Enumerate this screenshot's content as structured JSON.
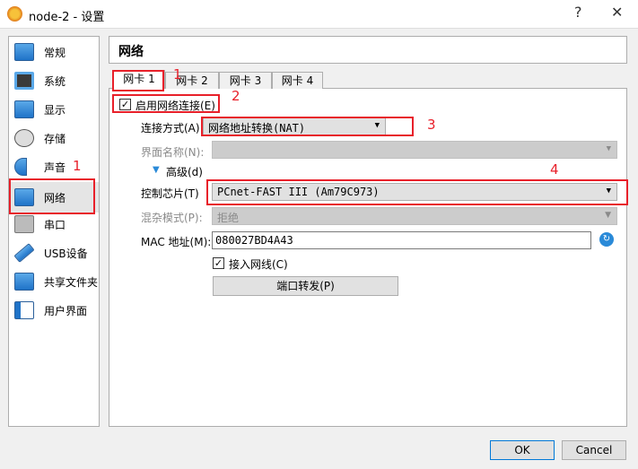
{
  "window": {
    "title": "node-2 - 设置",
    "help": "?",
    "close": "✕"
  },
  "sidebar": {
    "items": [
      {
        "label": "常规"
      },
      {
        "label": "系统"
      },
      {
        "label": "显示"
      },
      {
        "label": "存储"
      },
      {
        "label": "声音"
      },
      {
        "label": "网络"
      },
      {
        "label": "串口"
      },
      {
        "label": "USB设备"
      },
      {
        "label": "共享文件夹"
      },
      {
        "label": "用户界面"
      }
    ],
    "selected": "网络"
  },
  "header": {
    "title": "网络"
  },
  "tabs": [
    {
      "label": "网卡 1"
    },
    {
      "label": "网卡 2"
    },
    {
      "label": "网卡 3"
    },
    {
      "label": "网卡 4"
    }
  ],
  "form": {
    "enable_label": "启用网络连接(E)",
    "enable_checked": true,
    "attach_label": "连接方式(A):",
    "attach_value": "网络地址转换(NAT)",
    "iface_label": "界面名称(N):",
    "iface_value": "",
    "advanced_label": "高级(d)",
    "adapter_label": "控制芯片(T)",
    "adapter_value": "PCnet-FAST III (Am79C973)",
    "promisc_label": "混杂模式(P):",
    "promisc_value": "拒绝",
    "mac_label": "MAC 地址(M):",
    "mac_value": "080027BD4A43",
    "cable_label": "接入网线(C)",
    "cable_checked": true,
    "portfwd_label": "端口转发(P)"
  },
  "annotations": [
    "1",
    "2",
    "3",
    "4",
    "1"
  ],
  "footer": {
    "ok": "OK",
    "cancel": "Cancel"
  },
  "colors": {
    "annotation": "#e8202a"
  }
}
